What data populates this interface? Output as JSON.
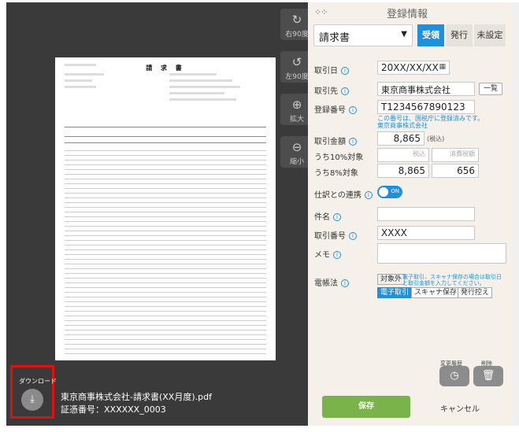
{
  "toolbar": {
    "rotate_right": "右90度",
    "rotate_left": "左90度",
    "zoom_in": "拡大",
    "zoom_out": "縮小"
  },
  "preview": {
    "doc_title": "請 求 書"
  },
  "download": {
    "label": "ダウンロード"
  },
  "file": {
    "name": "東京商事株式会社-請求書(XX月度).pdf",
    "evidence_number": "証憑番号：XXXXXX_0003"
  },
  "panel": {
    "title": "登録情報",
    "doc_type": "請求書",
    "tabs": [
      {
        "label": "受領",
        "active": true
      },
      {
        "label": "発行",
        "active": false
      },
      {
        "label": "未設定",
        "active": false
      }
    ],
    "date_label": "取引日",
    "date_value": "20XX/XX/XX",
    "partner_label": "取引先",
    "partner_value": "東京商事株式会社",
    "partner_list_button": "一覧",
    "reg_no_label": "登録番号",
    "reg_no_value": "T1234567890123",
    "reg_note_1": "この番号は、国税庁に登録済みです。",
    "reg_note_2": "東京商事株式会社",
    "amount_label": "取引金額",
    "amount_value": "8,865",
    "amount_tax_note": "(税込)",
    "tax10_label": "うち10%対象",
    "tax10_incl_placeholder": "税込",
    "tax10_tax_placeholder": "消費税額",
    "tax8_label": "うち8%対象",
    "tax8_incl_value": "8,865",
    "tax8_tax_value": "656",
    "journal_link_label": "仕訳との連携",
    "journal_toggle": "ON",
    "subject_label": "件名",
    "txn_no_label": "取引番号",
    "txn_no_value": "XXXX",
    "memo_label": "メモ",
    "ebook_label": "電帳法",
    "ebook_outside": "対象外",
    "ebook_note_1": "電子取引、スキャナ保存の場合は取引日",
    "ebook_note_2": "と取引金額を入力してください。",
    "ebook_types": [
      {
        "label": "電子取引",
        "active": true
      },
      {
        "label": "スキャナ保存",
        "active": false
      },
      {
        "label": "発行控え",
        "active": false
      }
    ],
    "history_label": "変更履歴",
    "delete_label": "削除",
    "save_button": "保存",
    "cancel_button": "キャンセル"
  },
  "icons": {
    "rotate_right": "rotate-right-icon",
    "rotate_left": "rotate-left-icon",
    "zoom_in": "zoom-in-icon",
    "zoom_out": "zoom-out-icon",
    "download": "download-icon",
    "calendar": "calendar-icon",
    "history": "clock-icon",
    "delete": "trash-icon",
    "info": "info-icon",
    "drag": "drag-handle-icon"
  },
  "colors": {
    "accent": "#1e90e0",
    "save": "#7ab34a",
    "highlight_border": "#e01010",
    "viewer_bg": "#3a3a3a",
    "panel_bg": "#f5f1ea"
  }
}
